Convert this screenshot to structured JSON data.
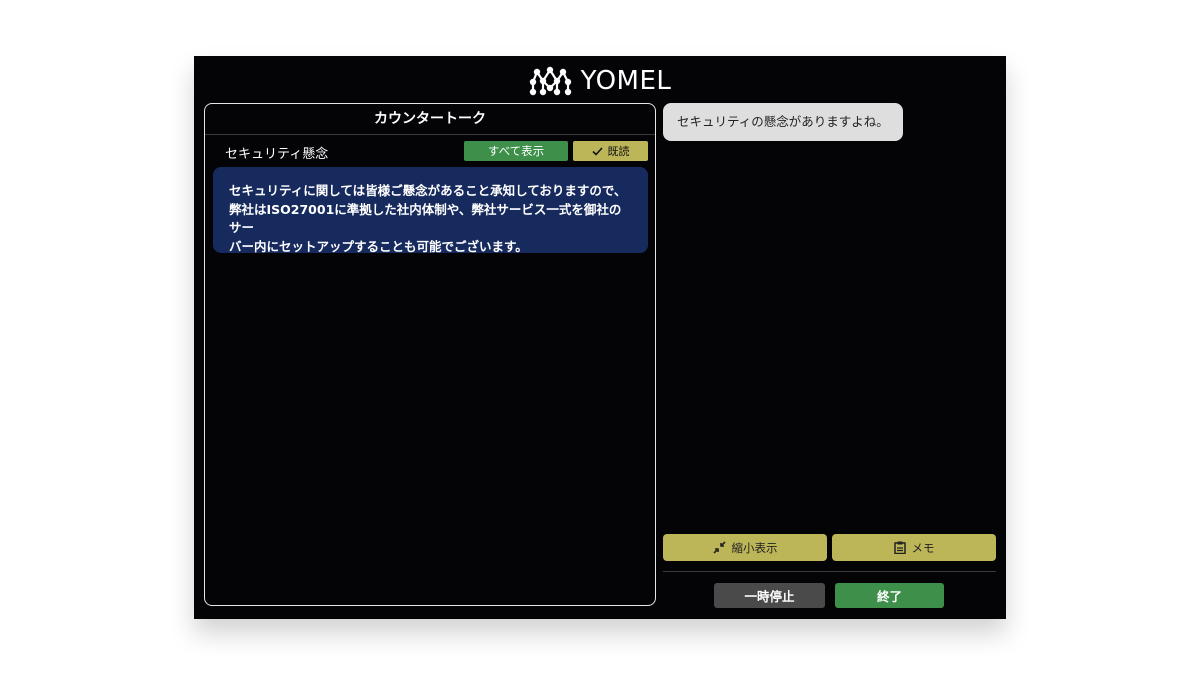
{
  "header": {
    "logo_text": "YOMEL",
    "logo_icon": "molecule-logo-icon"
  },
  "left_panel": {
    "title": "カウンタートーク",
    "topic": "セキュリティ懸念",
    "show_all_label": "すべて表示",
    "read_label": "既読",
    "message_lines": [
      "セキュリティに関しては皆様ご懸念があること承知しておりますので、",
      "弊社はISO27001に準拠した社内体制や、弊社サービス一式を御社のサー",
      "バー内にセットアップすることも可能でございます。"
    ]
  },
  "chat": {
    "bubble_text": "セキュリティの懸念がありますよね。"
  },
  "controls": {
    "shrink_label": "縮小表示",
    "memo_label": "メモ",
    "pause_label": "一時停止",
    "end_label": "終了"
  },
  "colors": {
    "background": "#040306",
    "green": "#3d8f49",
    "olive": "#bdb659",
    "message_bg": "#172a5e",
    "bubble_bg": "#dedede",
    "gray_button": "#4a4a4a"
  }
}
